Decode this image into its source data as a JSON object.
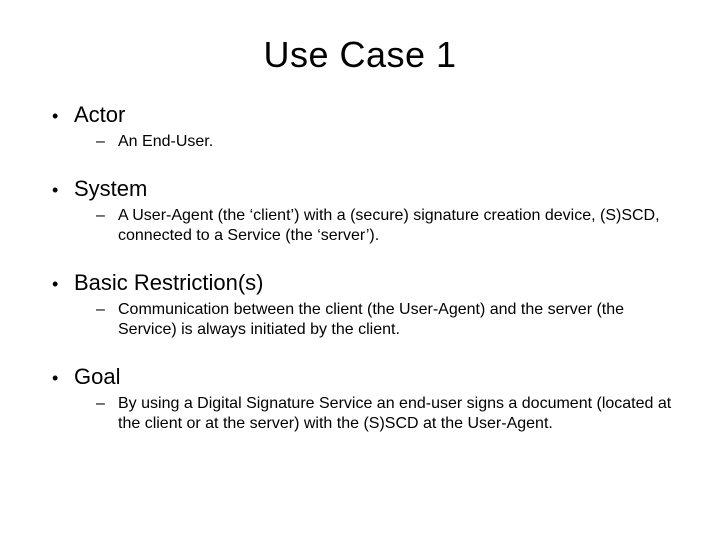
{
  "title": "Use Case 1",
  "sections": [
    {
      "heading": "Actor",
      "items": [
        "An End-User."
      ]
    },
    {
      "heading": "System",
      "items": [
        "A User-Agent (the ‘client’) with a (secure) signature creation device, (S)SCD, connected to a Service (the ‘server’)."
      ]
    },
    {
      "heading": "Basic Restriction(s)",
      "items": [
        "Communication between the client (the User-Agent) and the server (the Service) is always initiated by the client."
      ]
    },
    {
      "heading": "Goal",
      "items": [
        "By using a Digital Signature Service an end-user signs a document (located at the client or at the server) with the (S)SCD at the User-Agent."
      ]
    }
  ]
}
